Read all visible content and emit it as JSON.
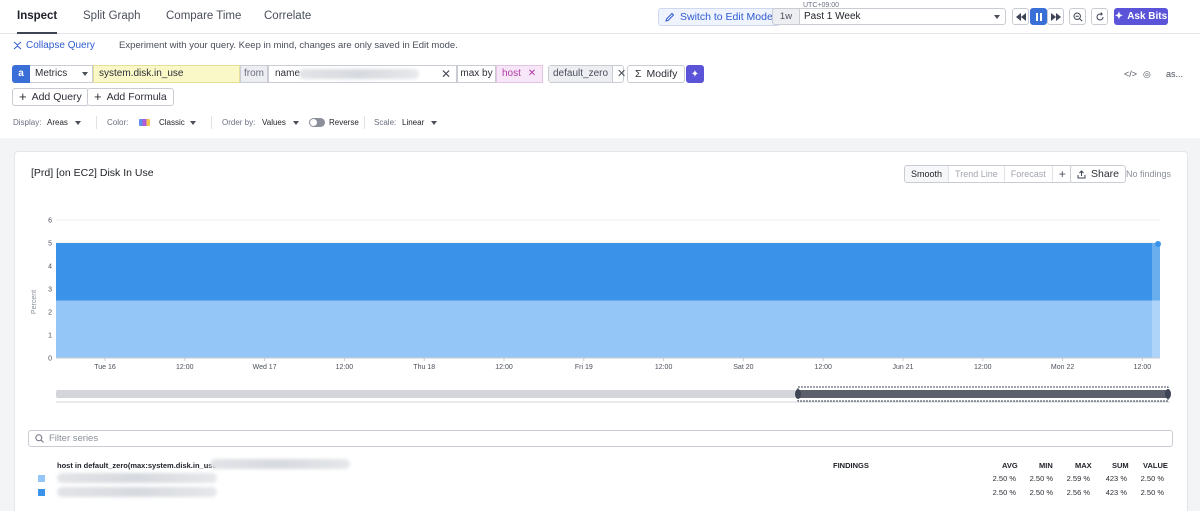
{
  "tabs": [
    {
      "label": "Inspect",
      "active": true
    },
    {
      "label": "Split Graph",
      "active": false
    },
    {
      "label": "Compare Time",
      "active": false
    },
    {
      "label": "Correlate",
      "active": false
    }
  ],
  "header": {
    "edit_mode_label": "Switch to Edit Mode",
    "timezone": "UTC+09:00",
    "period_badge": "1w",
    "period_label": "Past 1 Week",
    "ask_bits_label": "Ask Bits"
  },
  "query_bar": {
    "collapse_label": "Collapse Query",
    "hint": "Experiment with your query. Keep in mind, changes are only saved in Edit mode.",
    "letter": "a",
    "source": "Metrics",
    "metric": "system.disk.in_use",
    "from_label": "from",
    "name_label": "name",
    "max_by_label": "max by",
    "group_by": "host",
    "function": "default_zero",
    "modify_label": "Modify",
    "as_label": "as...",
    "add_query_label": "Add Query",
    "add_formula_label": "Add Formula"
  },
  "options": {
    "display_label": "Display:",
    "display_value": "Areas",
    "color_label": "Color:",
    "color_value": "Classic",
    "order_label": "Order by:",
    "order_value": "Values",
    "reverse_label": "Reverse",
    "scale_label": "Scale:",
    "scale_value": "Linear"
  },
  "panel": {
    "title": "[Prd] [on EC2] Disk In Use",
    "smooth": "Smooth",
    "trend_line": "Trend Line",
    "forecast": "Forecast",
    "share": "Share",
    "no_findings": "No findings"
  },
  "chart_data": {
    "type": "area",
    "stacked": true,
    "ylabel": "Percent",
    "ylim": [
      0,
      6
    ],
    "yticks": [
      "0",
      "1",
      "2",
      "3",
      "4",
      "5",
      "6"
    ],
    "xticks": [
      "Tue 16",
      "12:00",
      "Wed 17",
      "12:00",
      "Thu 18",
      "12:00",
      "Fri 19",
      "12:00",
      "Sat 20",
      "12:00",
      "Jun 21",
      "12:00",
      "Mon 22",
      "12:00"
    ],
    "series": [
      {
        "values": [
          2.5,
          2.5
        ],
        "color": "#94c6f7"
      },
      {
        "values": [
          2.5,
          2.5
        ],
        "color": "#3a93e8"
      }
    ],
    "grid": true
  },
  "legend": {
    "filter_placeholder": "Filter series",
    "column_host": "host in default_zero(max:system.disk.in_use",
    "column_findings": "FINDINGS",
    "columns": [
      "AVG",
      "MIN",
      "MAX",
      "SUM",
      "VALUE"
    ],
    "rows": [
      {
        "color": "#94c6f7",
        "values": [
          "2.50 %",
          "2.50 %",
          "2.59 %",
          "423 %",
          "2.50 %"
        ]
      },
      {
        "color": "#3a93e8",
        "values": [
          "2.50 %",
          "2.50 %",
          "2.56 %",
          "423 %",
          "2.50 %"
        ]
      }
    ]
  }
}
